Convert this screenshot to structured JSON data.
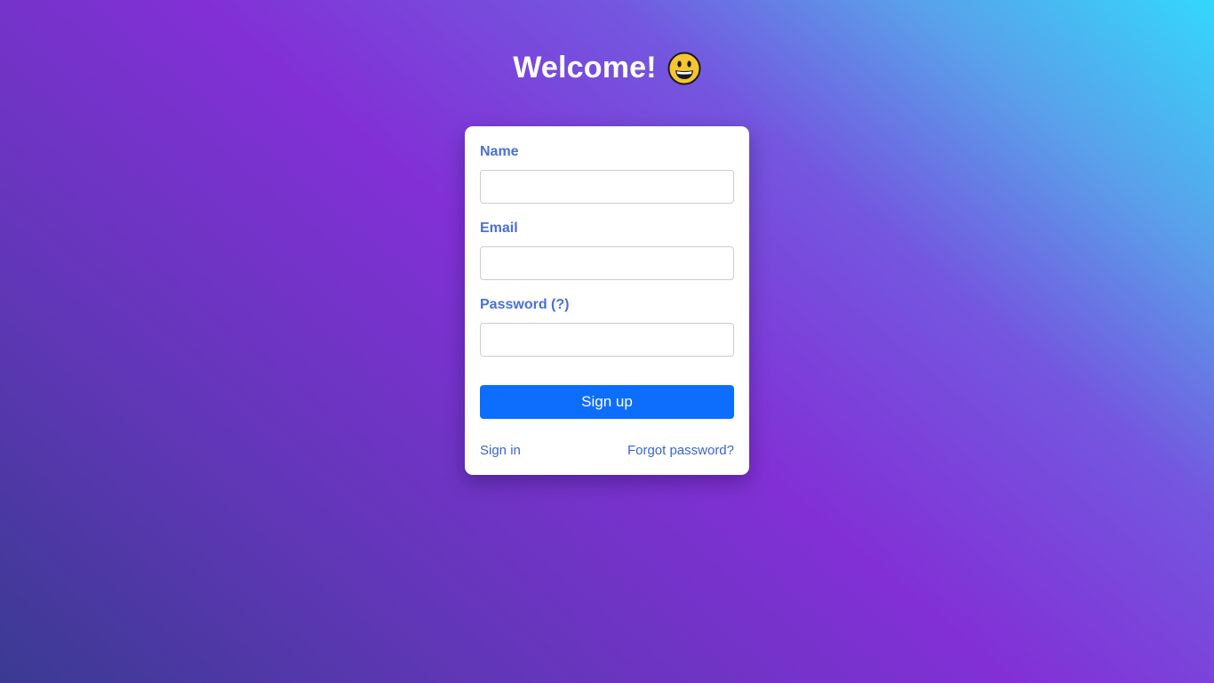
{
  "header": {
    "title": "Welcome!",
    "emoji_icon": "smiling-face-icon"
  },
  "form": {
    "fields": [
      {
        "label": "Name",
        "value": "",
        "placeholder": ""
      },
      {
        "label": "Email",
        "value": "",
        "placeholder": ""
      },
      {
        "label": "Password (?)",
        "value": "",
        "placeholder": ""
      }
    ],
    "submit_label": "Sign up"
  },
  "links": {
    "sign_in": "Sign in",
    "forgot_password": "Forgot password?"
  },
  "colors": {
    "accent": "#0d6efd",
    "label": "#4a6fd8",
    "link": "#3b63d1"
  }
}
